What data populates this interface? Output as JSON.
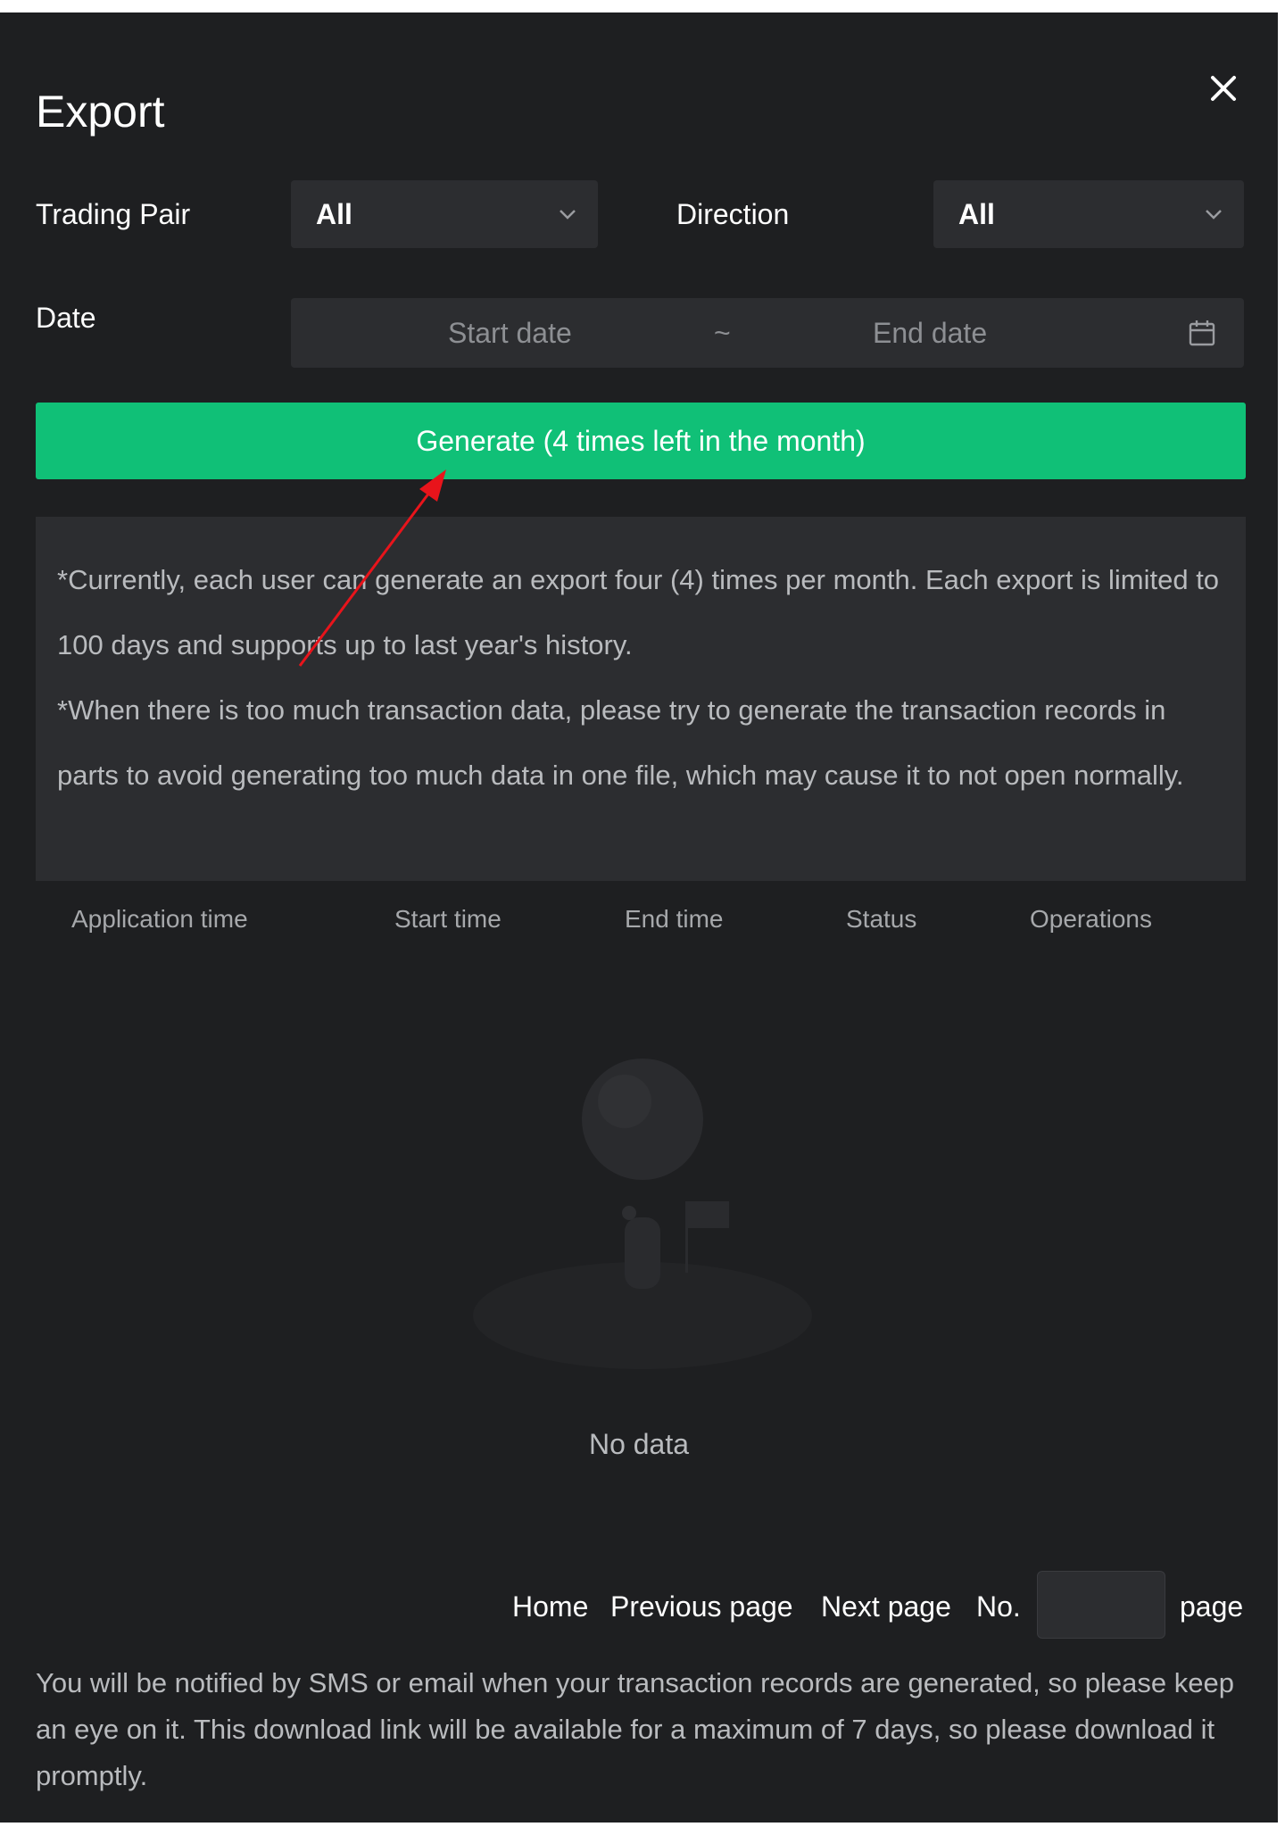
{
  "modal": {
    "title": "Export",
    "close_icon": "close-icon"
  },
  "filters": {
    "trading_pair_label": "Trading Pair",
    "trading_pair_value": "All",
    "direction_label": "Direction",
    "direction_value": "All",
    "date_label": "Date",
    "start_date_placeholder": "Start date",
    "range_separator": "~",
    "end_date_placeholder": "End date",
    "calendar_icon": "calendar-icon",
    "chevron_icon": "chevron-down-icon"
  },
  "generate_button": "Generate (4 times left in the month)",
  "notice": {
    "line1": "*Currently, each user can generate an export four (4) times per month. Each export is limited to 100 days and supports up to last year's history.",
    "line2": "*When there is too much transaction data, please try to generate the transaction records in parts to avoid generating too much data in one file, which may cause it to not open normally."
  },
  "table": {
    "columns": [
      "Application time",
      "Start time",
      "End time",
      "Status",
      "Operations"
    ],
    "empty_text": "No data"
  },
  "pagination": {
    "home": "Home",
    "previous": "Previous page",
    "next": "Next page",
    "no_label": "No.",
    "page_label": "page",
    "page_input_value": ""
  },
  "footer_note": "You will be notified by SMS or email when your transaction records are generated, so please keep an eye on it. This download link will be available for a maximum of 7 days, so please download it promptly.",
  "annotation": {
    "arrow_color": "#e8141b"
  },
  "colors": {
    "modal_bg": "#1e1f21",
    "field_bg": "#2c2d30",
    "accent_green": "#10c077"
  }
}
